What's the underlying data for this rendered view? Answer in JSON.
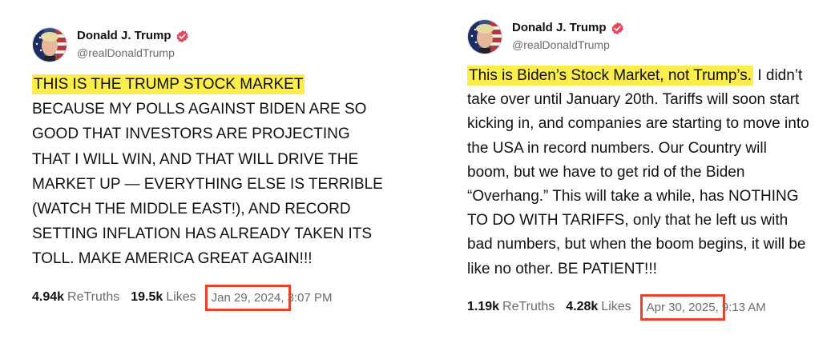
{
  "posts": [
    {
      "display_name": "Donald J. Trump",
      "handle": "@realDonaldTrump",
      "highlight": "THIS IS THE TRUMP STOCK MARKET",
      "body": "BECAUSE MY POLLS AGAINST BIDEN ARE SO GOOD THAT INVESTORS ARE PROJECTING THAT I WILL WIN, AND THAT WILL DRIVE THE MARKET UP — EVERYTHING ELSE IS TERRIBLE (WATCH THE MIDDLE EAST!), AND RECORD SETTING INFLATION HAS ALREADY TAKEN ITS TOLL. MAKE AMERICA GREAT AGAIN!!!",
      "retruths_count": "4.94k",
      "retruths_label": "ReTruths",
      "likes_count": "19.5k",
      "likes_label": "Likes",
      "date": "Jan 29, 2024,",
      "time": "3:07 PM"
    },
    {
      "display_name": "Donald J. Trump",
      "handle": "@realDonaldTrump",
      "highlight": "This is Biden’s Stock Market, not Trump’s.",
      "body": "I didn’t take over until January 20th. Tariffs will soon start kicking in, and companies are starting to move into the USA in record numbers. Our Country will boom, but we have to get rid of the Biden “Overhang.” This will take a while, has NOTHING TO DO WITH TARIFFS, only that he left us with bad numbers, but when the boom begins, it will be like no other. BE PATIENT!!!",
      "retruths_count": "1.19k",
      "retruths_label": "ReTruths",
      "likes_count": "4.28k",
      "likes_label": "Likes",
      "date": "Apr 30, 2025,",
      "time": "9:13 AM"
    }
  ],
  "colors": {
    "highlight": "#fbed4b",
    "annotation_box": "#e8432a",
    "verified_badge": "#e8455d",
    "muted_text": "#6b6b6b"
  },
  "icons": [
    "avatar",
    "verified-badge-icon"
  ]
}
